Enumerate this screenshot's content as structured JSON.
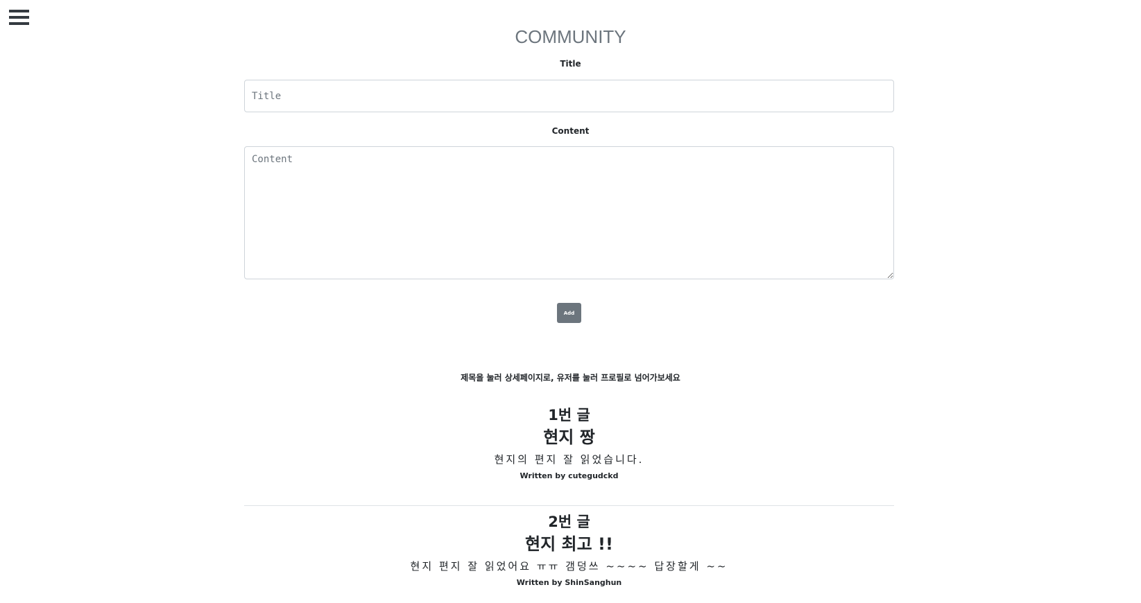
{
  "menu": {
    "icon": "hamburger-menu-icon"
  },
  "page": {
    "title": "COMMUNITY"
  },
  "form": {
    "title_label": "Title",
    "title_placeholder": "Title",
    "title_value": "",
    "content_label": "Content",
    "content_placeholder": "Content",
    "content_value": "",
    "add_label": "Add"
  },
  "hint": "제목을 눌러 상세페이지로, 유저를 눌러 프로필로 넘어가보세요",
  "posts": [
    {
      "number": "1번 글",
      "title": "현지 짱",
      "content": "현지의 편지 잘 읽었습니다.",
      "author": "Written by cutegudckd"
    },
    {
      "number": "2번 글",
      "title": "현지 최고 !!",
      "content": "현지 편지 잘 읽었어요 ㅠㅠ 갬덩쓰 ~~~~ 답장할게 ~~",
      "author": "Written by ShinSanghun"
    }
  ],
  "colors": {
    "title_gray": "#6c757d",
    "button_bg": "#6c757d",
    "text_dark": "#212529",
    "border": "#ced4da"
  }
}
